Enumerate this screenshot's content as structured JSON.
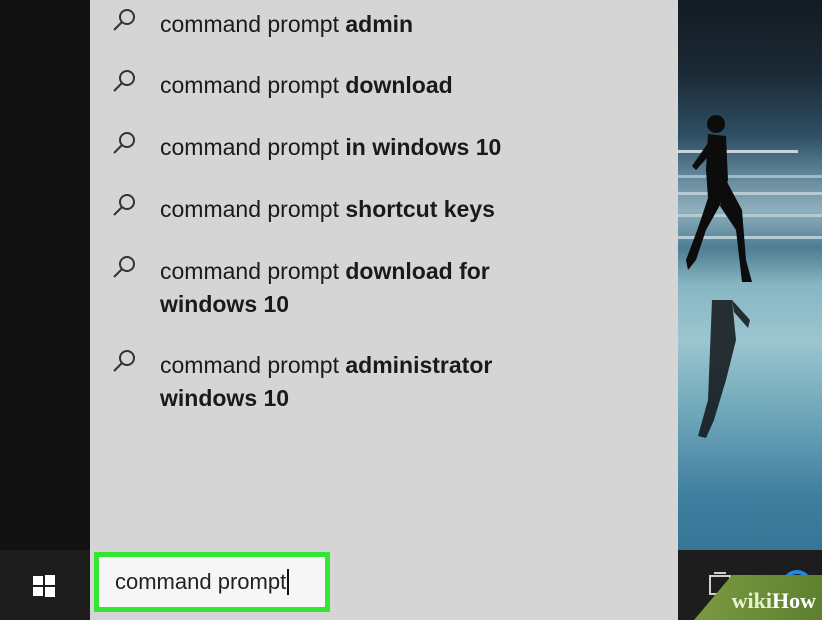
{
  "start_menu": {
    "suggestions": [
      {
        "prefix": "command prompt",
        "bold": "admin"
      },
      {
        "prefix": "command prompt",
        "bold": "download"
      },
      {
        "prefix": "command prompt",
        "bold": "in windows 10"
      },
      {
        "prefix": "command prompt",
        "bold": "shortcut keys"
      },
      {
        "prefix": "command prompt",
        "bold": "download for windows 10"
      },
      {
        "prefix": "command prompt",
        "bold": "administrator windows 10"
      }
    ]
  },
  "taskbar": {
    "search_value": "command prompt",
    "icons": [
      "windows-start-icon",
      "task-view-icon",
      "cortana-icon"
    ]
  },
  "watermark": {
    "part1": "wiki",
    "part2": "How"
  },
  "colors": {
    "highlight": "#33e633",
    "panel": "#d5d5d5",
    "taskbar": "#1d1d1d"
  }
}
